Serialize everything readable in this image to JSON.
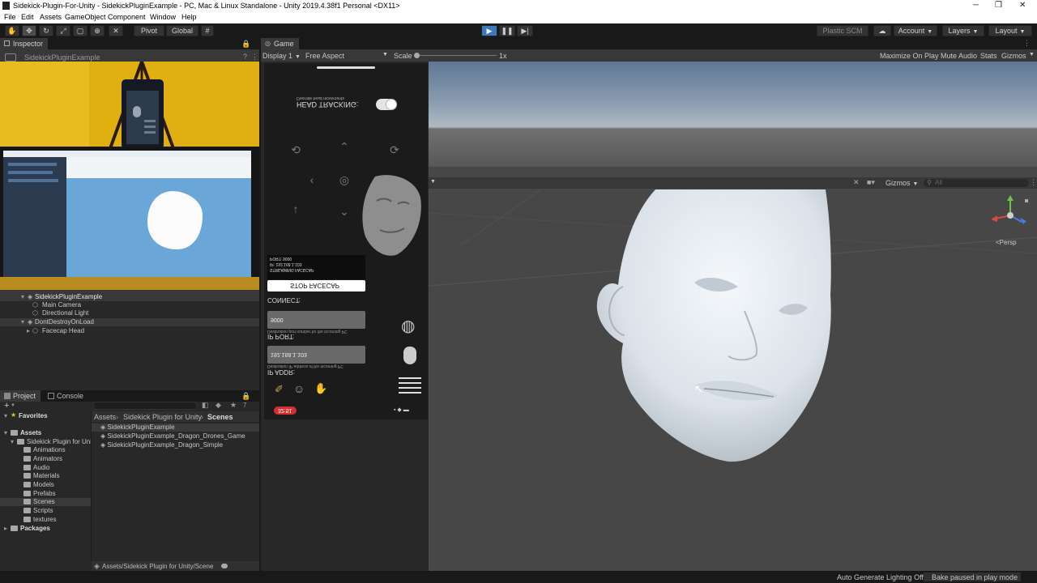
{
  "window": {
    "title": "Sidekick-Plugin-For-Unity - SidekickPluginExample - PC, Mac & Linux Standalone - Unity 2019.4.38f1 Personal <DX11>",
    "minimize": "─",
    "maximize": "❐",
    "close": "✕"
  },
  "menu": [
    "File",
    "Edit",
    "Assets",
    "GameObject",
    "Component",
    "Window",
    "Help"
  ],
  "toolbar": {
    "pivot_label": "Pivot",
    "global_label": "Global",
    "plastic_label": "Plastic SCM",
    "account_label": "Account",
    "layers_label": "Layers",
    "layout_label": "Layout"
  },
  "inspector": {
    "tab_label": "Inspector",
    "object_name": "SidekickPluginExample"
  },
  "hierarchy": {
    "rows": [
      "SidekickPluginExample",
      "Main Camera",
      "Directional Light",
      "DontDestroyOnLoad",
      "Facecap Head"
    ]
  },
  "project": {
    "tabs": [
      "Project",
      "Console"
    ],
    "favorites_label": "Favorites",
    "assets_label": "Assets",
    "plugin_label": "Sidekick Plugin for Unity",
    "folders": [
      "Animations",
      "Animators",
      "Audio",
      "Materials",
      "Models",
      "Prefabs",
      "Scenes",
      "Scripts",
      "textures"
    ],
    "packages_label": "Packages",
    "breadcrumb": [
      "Assets",
      "Sidekick Plugin for Unity",
      "Scenes"
    ],
    "files": [
      "SidekickPluginExample",
      "SidekickPluginExample_Dragon_Drones_Game",
      "SidekickPluginExample_Dragon_Simple"
    ],
    "footer_path": "Assets/Sidekick Plugin for Unity/Scene",
    "hidden_count": "7"
  },
  "game": {
    "tab_label": "Game",
    "display_label": "Display 1",
    "aspect_label": "Free Aspect",
    "scale_label": "Scale",
    "scale_value": "1x",
    "maximize_label": "Maximize On Play",
    "mute_label": "Mute Audio",
    "stats_label": "Stats",
    "gizmos_label": "Gizmos"
  },
  "scene": {
    "gizmos_label": "Gizmos",
    "search_placeholder": "All",
    "persp_label": "Persp"
  },
  "phone": {
    "head_tracking": "HEAD TRACKING:",
    "head_tracking_sub": "Override head movements",
    "head_tracking_on": true,
    "streaming_text": "STREAMING FACECAP",
    "ip_text": "IP: 192.168.1.103",
    "port_text": "PORT: 9000",
    "stop_button": "STOP FACECAP",
    "connect_label": "CONNECT:",
    "port_label": "IP PORT:",
    "port_value": "9000",
    "port_sub": "Destination port number for the incoming PC",
    "ip_label": "IP ADDR:",
    "ip_value": "192.168.1.103",
    "ip_sub": "Destination IP address of the incoming PC",
    "rec_time": "32:51"
  },
  "status": {
    "lighting": "Auto Generate Lighting Off",
    "bake": "Bake paused in play mode"
  },
  "colors": {
    "accent_play": "#3a79bb",
    "rec_red": "#d32f2f"
  }
}
